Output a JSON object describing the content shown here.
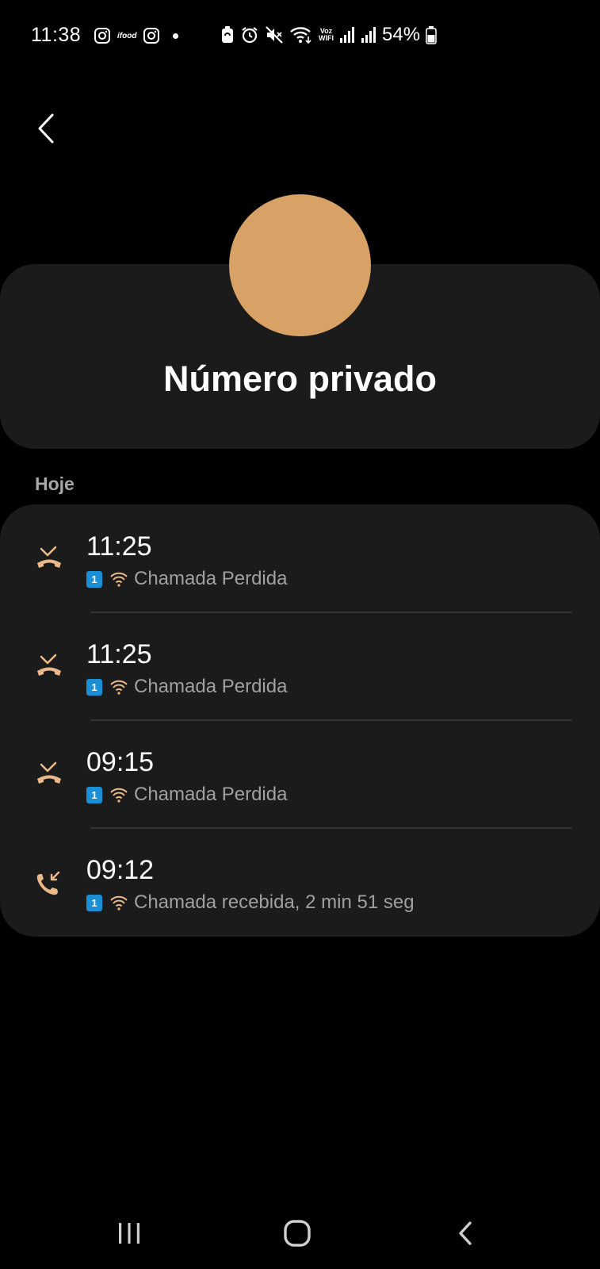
{
  "status_bar": {
    "time": "11:38",
    "left_icons": [
      "instagram-icon",
      "ifood-icon",
      "instagram-icon",
      "dot-icon"
    ],
    "ifood_label": "ifood",
    "right_icons": [
      "battery-saver-icon",
      "alarm-icon",
      "mute-icon",
      "wifi-icon",
      "voz-wifi-icon",
      "signal-icon",
      "signal-icon",
      "battery-icon"
    ],
    "voz_label": "Voz",
    "wifi_label": "WIFI",
    "battery": "54%"
  },
  "header": {
    "back_icon": "back-arrow-icon",
    "avatar_color": "#d8a166",
    "contact_name": "Número privado"
  },
  "section": {
    "label": "Hoje"
  },
  "calls": [
    {
      "time": "11:25",
      "sim": "1",
      "type_icon": "missed-call-icon",
      "description": "Chamada Perdida"
    },
    {
      "time": "11:25",
      "sim": "1",
      "type_icon": "missed-call-icon",
      "description": "Chamada Perdida"
    },
    {
      "time": "09:15",
      "sim": "1",
      "type_icon": "missed-call-icon",
      "description": "Chamada Perdida"
    },
    {
      "time": "09:12",
      "sim": "1",
      "type_icon": "incoming-call-icon",
      "description": "Chamada recebida, 2 min 51 seg"
    }
  ],
  "colors": {
    "accent": "#e9b98a",
    "sim_badge": "#1a8fd6",
    "card_bg": "#1b1b1b"
  },
  "nav_bar": {
    "buttons": [
      "recent-apps-icon",
      "home-icon",
      "back-icon"
    ]
  }
}
